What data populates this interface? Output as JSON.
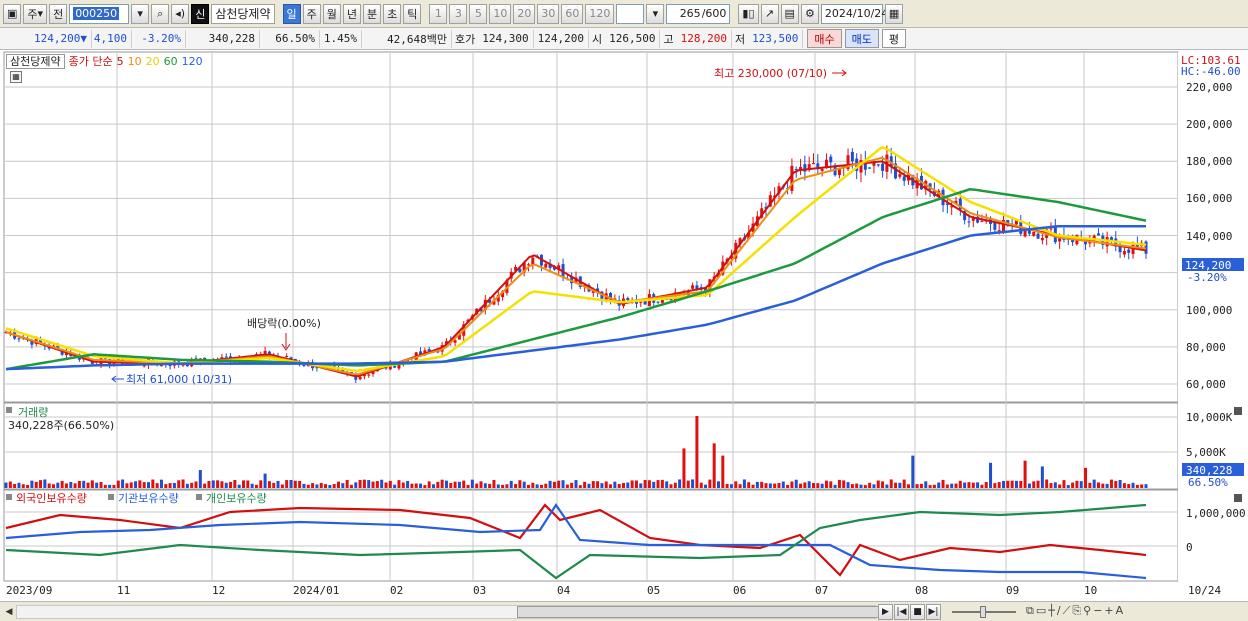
{
  "toolbar": {
    "market_type": "주",
    "prev_button": "전",
    "stock_code": "000250",
    "badge": "신",
    "stock_name": "삼천당제약",
    "periods": [
      "일",
      "주",
      "월",
      "년",
      "분",
      "초",
      "틱"
    ],
    "active_period": "일",
    "units": [
      "1",
      "3",
      "5",
      "10",
      "20",
      "30",
      "60",
      "120"
    ],
    "count_value": "265",
    "count_max": "/600",
    "date": "2024/10/24"
  },
  "quote": {
    "price": "124,200",
    "change": "4,100",
    "change_pct": "-3.20%",
    "volume": "340,228",
    "volume_ratio": "66.50%",
    "turnover": "1.45%",
    "amount": "42,648백만",
    "ask_label": "호가",
    "ask": "124,300",
    "bid": "124,200",
    "open_label": "시",
    "open": "126,500",
    "high_label": "고",
    "high": "128,200",
    "low_label": "저",
    "low": "123,500",
    "buy_label": "매수",
    "sell_label": "매도",
    "avg_label": "평"
  },
  "legend": {
    "name": "삼천당제약",
    "ma_title": "종가 단순",
    "ma_periods": [
      {
        "label": "5",
        "color": "#d01010"
      },
      {
        "label": "10",
        "color": "#ef8c12"
      },
      {
        "label": "20",
        "color": "#f5e000"
      },
      {
        "label": "60",
        "color": "#1e9a3e"
      },
      {
        "label": "120",
        "color": "#2a5fd8"
      }
    ]
  },
  "price_panel": {
    "lc": "LC:103.61",
    "hc": "HC:-46.00",
    "y_ticks": [
      "220,000",
      "200,000",
      "180,000",
      "160,000",
      "140,000",
      "120,000",
      "100,000",
      "80,000",
      "60,000"
    ],
    "current_price_tag": "124,200",
    "current_change_tag": "-3.20%",
    "high_annotation": "최고 230,000 (07/10)",
    "low_annotation": "최저 61,000 (10/31)",
    "dividend_annotation": "배당락(0.00%)"
  },
  "volume_panel": {
    "title": "거래량",
    "summary": "340,228주(66.50%)",
    "y_ticks": [
      "10,000K",
      "5,000K"
    ],
    "current_tag": "340,228",
    "current_pct": "66.50%"
  },
  "holding_panel": {
    "series": [
      {
        "name": "외국인보유수량",
        "color": "#d01010"
      },
      {
        "name": "기관보유수량",
        "color": "#2a5fd8"
      },
      {
        "name": "개인보유수량",
        "color": "#1e8a4e"
      }
    ],
    "y_ticks": [
      "1,000,000",
      "0"
    ]
  },
  "x_axis": {
    "labels": [
      "2023/09",
      "11",
      "12",
      "2024/01",
      "02",
      "03",
      "04",
      "05",
      "06",
      "07",
      "08",
      "09",
      "10",
      "10/24"
    ]
  },
  "colors": {
    "up": "#e01010",
    "down": "#1f4fd0",
    "grid": "#c9c9c9",
    "axis_bg": "#ffffff"
  },
  "chart_data": {
    "type": "line",
    "title": "",
    "x": [
      "2023/09",
      "11",
      "12",
      "2024/01",
      "02",
      "03",
      "04",
      "05",
      "06",
      "07",
      "08",
      "09",
      "10",
      "10/24"
    ],
    "ylim": [
      55000,
      235000
    ],
    "series": [
      {
        "name": "5",
        "values": [
          88000,
          72000,
          71000,
          76000,
          64000,
          80000,
          130000,
          103000,
          112000,
          175000,
          180000,
          150000,
          140000,
          132000
        ]
      },
      {
        "name": "10",
        "values": [
          88000,
          73000,
          71000,
          75000,
          65000,
          79000,
          125000,
          104000,
          110000,
          170000,
          182000,
          152000,
          139000,
          133000
        ]
      },
      {
        "name": "20",
        "values": [
          90000,
          75000,
          71000,
          74000,
          67000,
          75000,
          110000,
          104000,
          108000,
          150000,
          188000,
          158000,
          140000,
          135000
        ]
      },
      {
        "name": "60",
        "values": [
          68000,
          76000,
          73000,
          72000,
          70000,
          72000,
          84000,
          96000,
          110000,
          125000,
          150000,
          165000,
          158000,
          148000
        ]
      },
      {
        "name": "120",
        "values": [
          68000,
          70000,
          71000,
          71000,
          71000,
          72000,
          78000,
          84000,
          92000,
          105000,
          125000,
          140000,
          145000,
          145000
        ]
      }
    ]
  }
}
